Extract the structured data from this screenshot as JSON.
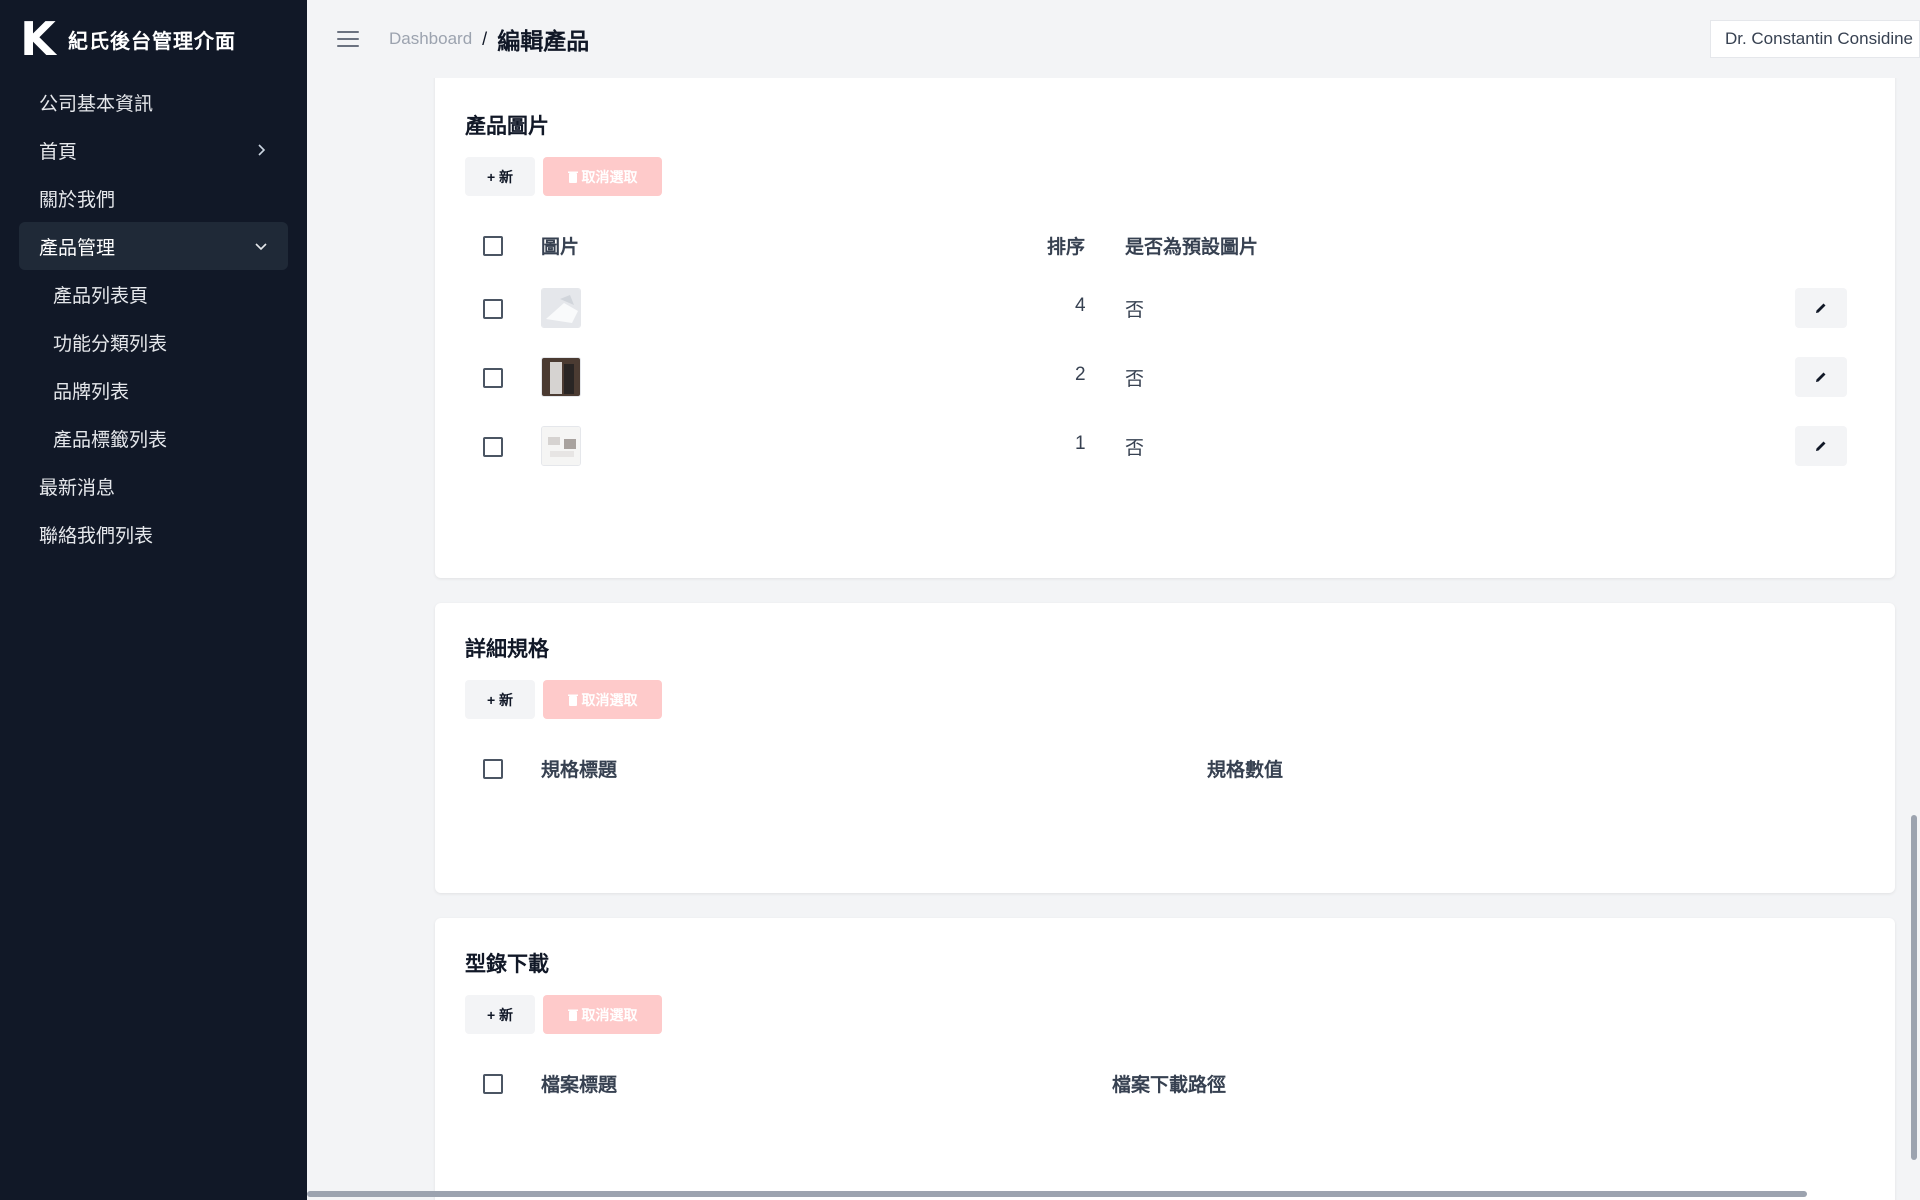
{
  "app": {
    "logo_letter": "K",
    "name": "紀氏後台管理介面"
  },
  "sidebar": {
    "items": [
      {
        "label": "公司基本資訊"
      },
      {
        "label": "首頁"
      },
      {
        "label": "關於我們"
      },
      {
        "label": "產品管理"
      },
      {
        "label": "最新消息"
      },
      {
        "label": "聯絡我們列表"
      }
    ],
    "sub_items": [
      {
        "label": "產品列表頁"
      },
      {
        "label": "功能分類列表"
      },
      {
        "label": "品牌列表"
      },
      {
        "label": "產品標籤列表"
      }
    ]
  },
  "header": {
    "breadcrumb_root": "Dashboard",
    "separator": "/",
    "title": "編輯產品",
    "user_name": "Dr. Constantin Considine"
  },
  "sections": {
    "images": {
      "title": "產品圖片",
      "new_label": "+ 新",
      "cancel_label": "取消選取",
      "columns": {
        "image": "圖片",
        "order": "排序",
        "default": "是否為預設圖片"
      },
      "rows": [
        {
          "order": "4",
          "is_default": "否"
        },
        {
          "order": "2",
          "is_default": "否"
        },
        {
          "order": "1",
          "is_default": "否"
        }
      ]
    },
    "specs": {
      "title": "詳細規格",
      "new_label": "+ 新",
      "cancel_label": "取消選取",
      "columns": {
        "spec_title": "規格標題",
        "spec_value": "規格數值"
      }
    },
    "catalog": {
      "title": "型錄下載",
      "new_label": "+ 新",
      "cancel_label": "取消選取",
      "columns": {
        "file_title": "檔案標題",
        "file_path": "檔案下載路徑"
      }
    }
  },
  "colors": {
    "sidebar_bg": "#111827",
    "active_item_bg": "#1f2937",
    "cancel_button_bg": "#fecaca",
    "page_bg": "#f3f4f6"
  }
}
